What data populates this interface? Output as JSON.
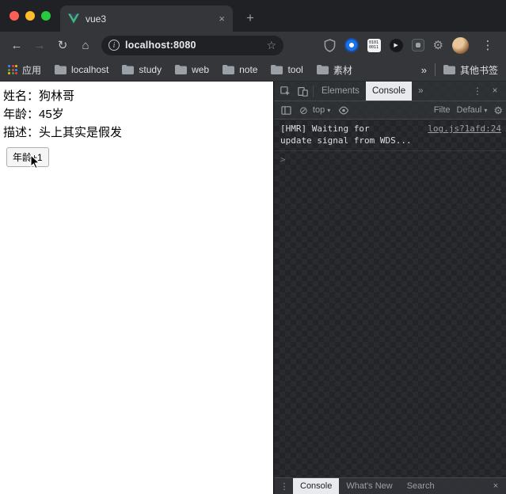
{
  "icons": {
    "back": "←",
    "forward": "→",
    "refresh": "↻",
    "home": "⌂",
    "info": "i",
    "star": "☆",
    "more_vertical": "⋮",
    "plus": "+",
    "close": "×",
    "chevrons": "»",
    "dropdown": "▾",
    "clear_block": "⊘",
    "gear": "⚙",
    "play": "▶"
  },
  "colors": {
    "vue_green": "#41b883",
    "vue_dark": "#35495e",
    "traffic_red": "#ff5f57",
    "traffic_yellow": "#febc2e",
    "traffic_green": "#28c840"
  },
  "tabstrip": {
    "title": "vue3"
  },
  "navbar": {
    "url": "localhost:8080",
    "ext_binary_row1": "0101",
    "ext_binary_row2": "0011"
  },
  "bookmarks": {
    "apps_label": "应用",
    "folders": [
      "localhost",
      "study",
      "web",
      "note",
      "tool",
      "素材"
    ],
    "other_label": "其他书签"
  },
  "page": {
    "line_name": "姓名：狗林哥",
    "line_age": "年龄：45岁",
    "line_desc": "描述：头上其实是假发",
    "button_label": "年龄+1"
  },
  "devtools": {
    "tab_elements": "Elements",
    "tab_console": "Console",
    "context": "top",
    "filter_label": "Filte",
    "levels_label": "Defaul",
    "console_message_line1": "[HMR] Waiting for",
    "console_message_line2": "update signal from WDS...",
    "source_link": "log.js?1afd:24",
    "prompt": ">",
    "bottom_console": "Console",
    "bottom_whats_new": "What's New",
    "bottom_search": "Search"
  }
}
